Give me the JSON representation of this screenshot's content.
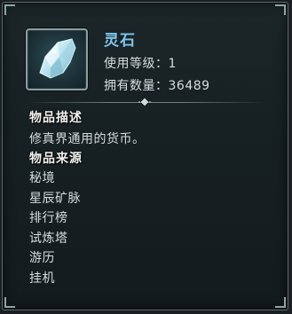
{
  "item": {
    "name": "灵石",
    "icon": "spirit-crystal-icon",
    "level_label": "使用等级：",
    "level_value": "1",
    "quantity_label": "拥有数量：",
    "quantity_value": "36489"
  },
  "description": {
    "title": "物品描述",
    "text": "修真界通用的货币。"
  },
  "sources": {
    "title": "物品来源",
    "items": [
      "秘境",
      "星辰矿脉",
      "排行榜",
      "试炼塔",
      "游历",
      "挂机"
    ]
  },
  "colors": {
    "name": "#7fc6ef",
    "text": "#d7dcdc",
    "heading": "#f2f2ee",
    "border": "#8a9ea2",
    "panel": "#172022"
  }
}
